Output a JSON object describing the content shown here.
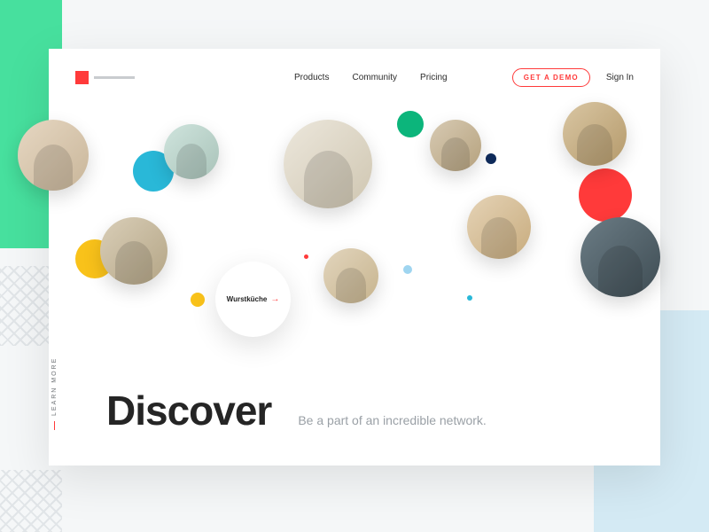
{
  "nav": {
    "products": "Products",
    "community": "Community",
    "pricing": "Pricing"
  },
  "cta": {
    "demo": "GET A DEMO",
    "signin": "Sign In"
  },
  "bubble": {
    "label": "Wurstküche",
    "arrow": "→"
  },
  "hero": {
    "title": "Discover",
    "subtitle": "Be a part of an incredible network."
  },
  "learnMore": "LEARN MORE",
  "colors": {
    "accent": "#ff3a3a",
    "green": "#47e09e",
    "yellow": "#f9c21a",
    "cyan": "#29b8d8",
    "darkgreen": "#0cb57b",
    "navy": "#0f2b5b",
    "red": "#ff3a3a",
    "lightblue": "#9fd5f0"
  }
}
